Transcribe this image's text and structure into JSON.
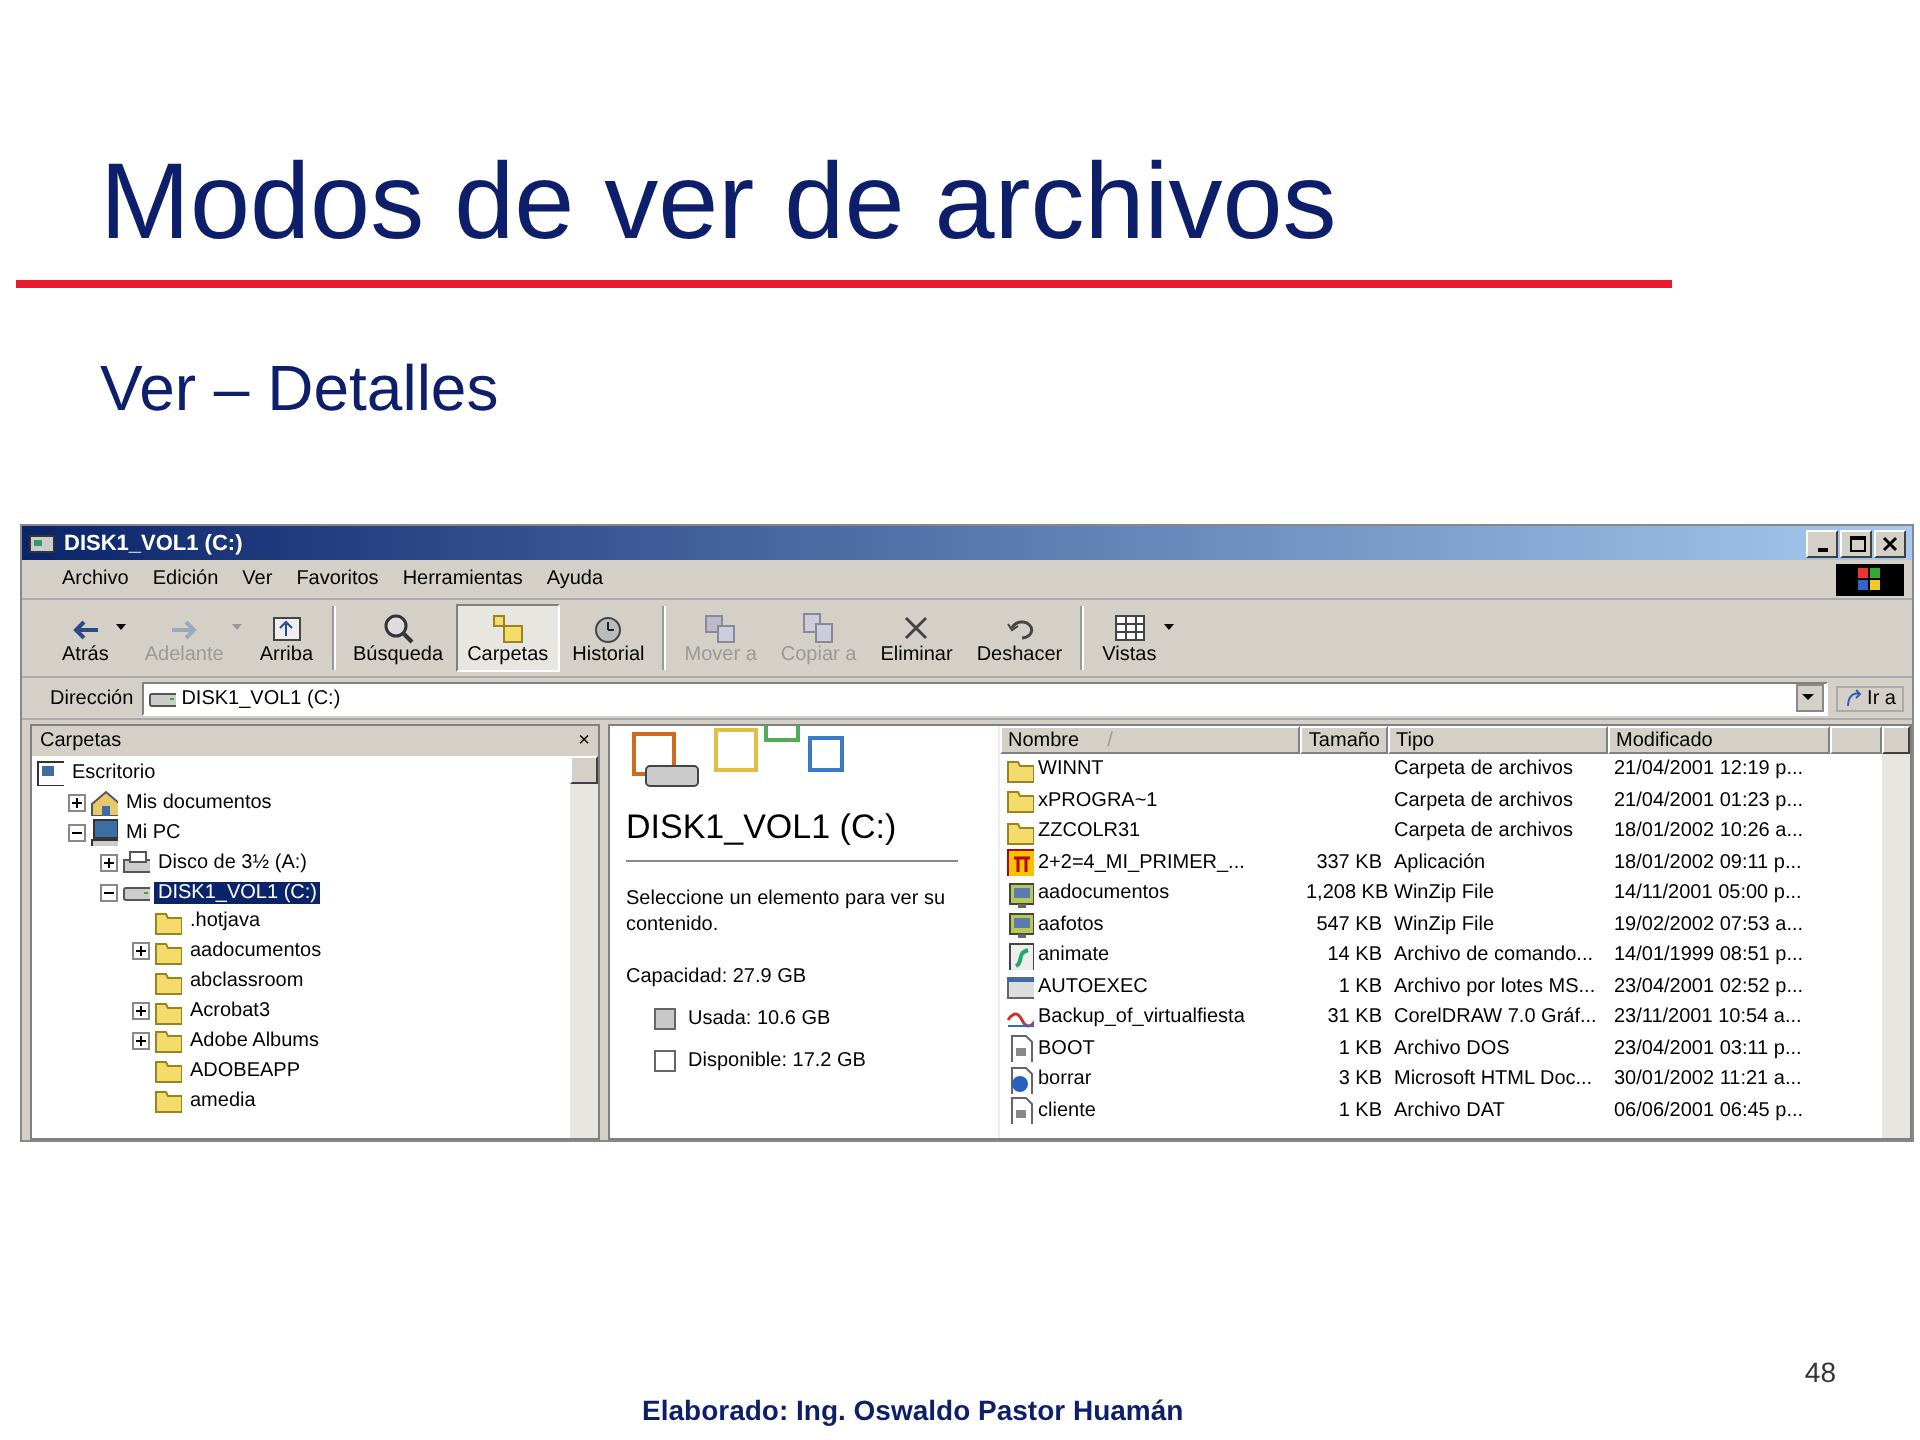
{
  "slide": {
    "title": "Modos de ver de archivos",
    "subtitle": "Ver – Detalles",
    "page_number": "48",
    "footer": "Elaborado: Ing. Oswaldo Pastor Huamán"
  },
  "window": {
    "title": "DISK1_VOL1 (C:)"
  },
  "menu": [
    "Archivo",
    "Edición",
    "Ver",
    "Favoritos",
    "Herramientas",
    "Ayuda"
  ],
  "toolbar": [
    {
      "kind": "button",
      "label": "Atrás",
      "disabled": false,
      "selected": false,
      "dropdown": true
    },
    {
      "kind": "button",
      "label": "Adelante",
      "disabled": true,
      "selected": false,
      "dropdown": true
    },
    {
      "kind": "button",
      "label": "Arriba",
      "disabled": false,
      "selected": false,
      "dropdown": false
    },
    {
      "kind": "separator"
    },
    {
      "kind": "button",
      "label": "Búsqueda",
      "disabled": false,
      "selected": false,
      "dropdown": false
    },
    {
      "kind": "button",
      "label": "Carpetas",
      "disabled": false,
      "selected": true,
      "dropdown": false
    },
    {
      "kind": "button",
      "label": "Historial",
      "disabled": false,
      "selected": false,
      "dropdown": false
    },
    {
      "kind": "separator"
    },
    {
      "kind": "button",
      "label": "Mover a",
      "disabled": true,
      "selected": false,
      "dropdown": false
    },
    {
      "kind": "button",
      "label": "Copiar a",
      "disabled": true,
      "selected": false,
      "dropdown": false
    },
    {
      "kind": "button",
      "label": "Eliminar",
      "disabled": false,
      "selected": false,
      "dropdown": false
    },
    {
      "kind": "button",
      "label": "Deshacer",
      "disabled": false,
      "selected": false,
      "dropdown": false
    },
    {
      "kind": "separator"
    },
    {
      "kind": "button",
      "label": "Vistas",
      "disabled": false,
      "selected": false,
      "dropdown": true
    }
  ],
  "address": {
    "label": "Dirección",
    "value": "DISK1_VOL1 (C:)",
    "go": "Ir a"
  },
  "folders_pane": {
    "title": "Carpetas",
    "close": "×",
    "tree": [
      {
        "label": "Escritorio",
        "kind": "desktop",
        "selected": false,
        "children": [
          {
            "label": "Mis documentos",
            "kind": "documents",
            "expanded": false,
            "selected": false
          },
          {
            "label": "Mi PC",
            "kind": "computer",
            "expanded": true,
            "selected": false,
            "children": [
              {
                "label": "Disco de 3½ (A:)",
                "kind": "floppy",
                "expanded": false,
                "selected": false
              },
              {
                "label": "DISK1_VOL1 (C:)",
                "kind": "drive",
                "expanded": true,
                "selected": true,
                "children": [
                  {
                    "label": ".hotjava",
                    "kind": "folder",
                    "selected": false
                  },
                  {
                    "label": "aadocumentos",
                    "kind": "folder",
                    "expanded": false,
                    "selected": false
                  },
                  {
                    "label": "abclassroom",
                    "kind": "folder",
                    "selected": false
                  },
                  {
                    "label": "Acrobat3",
                    "kind": "folder",
                    "expanded": false,
                    "selected": false
                  },
                  {
                    "label": "Adobe Albums",
                    "kind": "folder",
                    "expanded": false,
                    "selected": false
                  },
                  {
                    "label": "ADOBEAPP",
                    "kind": "folder",
                    "selected": false
                  },
                  {
                    "label": "amedia",
                    "kind": "folder",
                    "selected": false
                  }
                ]
              }
            ]
          }
        ]
      }
    ]
  },
  "info_panel": {
    "heading": "DISK1_VOL1 (C:)",
    "text": "Seleccione un elemento para ver su contenido.",
    "capacity": "Capacidad: 27.9 GB",
    "legend": [
      {
        "label": "Usada: 10.6 GB",
        "color": "#c8c8c8"
      },
      {
        "label": "Disponible: 17.2 GB",
        "color": "#ffffff"
      }
    ]
  },
  "table": {
    "columns": [
      "Nombre",
      "Tamaño",
      "Tipo",
      "Modificado"
    ],
    "sort_mark": "/",
    "rows": [
      {
        "kind": "folder",
        "name": "WINNT",
        "size": "",
        "type": "Carpeta de archivos",
        "modified": "21/04/2001 12:19 p..."
      },
      {
        "kind": "folder",
        "name": "xPROGRA~1",
        "size": "",
        "type": "Carpeta de archivos",
        "modified": "21/04/2001 01:23 p..."
      },
      {
        "kind": "folder",
        "name": "ZZCOLR31",
        "size": "",
        "type": "Carpeta de archivos",
        "modified": "18/01/2002 10:26 a..."
      },
      {
        "kind": "app",
        "name": "2+2=4_MI_PRIMER_...",
        "size": "337 KB",
        "type": "Aplicación",
        "modified": "18/01/2002 09:11 p..."
      },
      {
        "kind": "zip",
        "name": "aadocumentos",
        "size": "1,208 KB",
        "type": "WinZip File",
        "modified": "14/11/2001 05:00 p..."
      },
      {
        "kind": "zip",
        "name": "aafotos",
        "size": "547 KB",
        "type": "WinZip File",
        "modified": "19/02/2002 07:53 a..."
      },
      {
        "kind": "script",
        "name": "animate",
        "size": "14 KB",
        "type": "Archivo de comando...",
        "modified": "14/01/1999 08:51 p..."
      },
      {
        "kind": "batch",
        "name": "AUTOEXEC",
        "size": "1 KB",
        "type": "Archivo por lotes MS...",
        "modified": "23/04/2001 02:52 p..."
      },
      {
        "kind": "drawing",
        "name": "Backup_of_virtualfiesta",
        "size": "31 KB",
        "type": "CorelDRAW 7.0 Gráf...",
        "modified": "23/11/2001 10:54 a..."
      },
      {
        "kind": "file",
        "name": "BOOT",
        "size": "1 KB",
        "type": "Archivo DOS",
        "modified": "23/04/2001 03:11 p..."
      },
      {
        "kind": "web",
        "name": "borrar",
        "size": "3 KB",
        "type": "Microsoft HTML Doc...",
        "modified": "30/01/2002 11:21 a..."
      },
      {
        "kind": "file",
        "name": "cliente",
        "size": "1 KB",
        "type": "Archivo DAT",
        "modified": "06/06/2001 06:45 p..."
      }
    ]
  }
}
